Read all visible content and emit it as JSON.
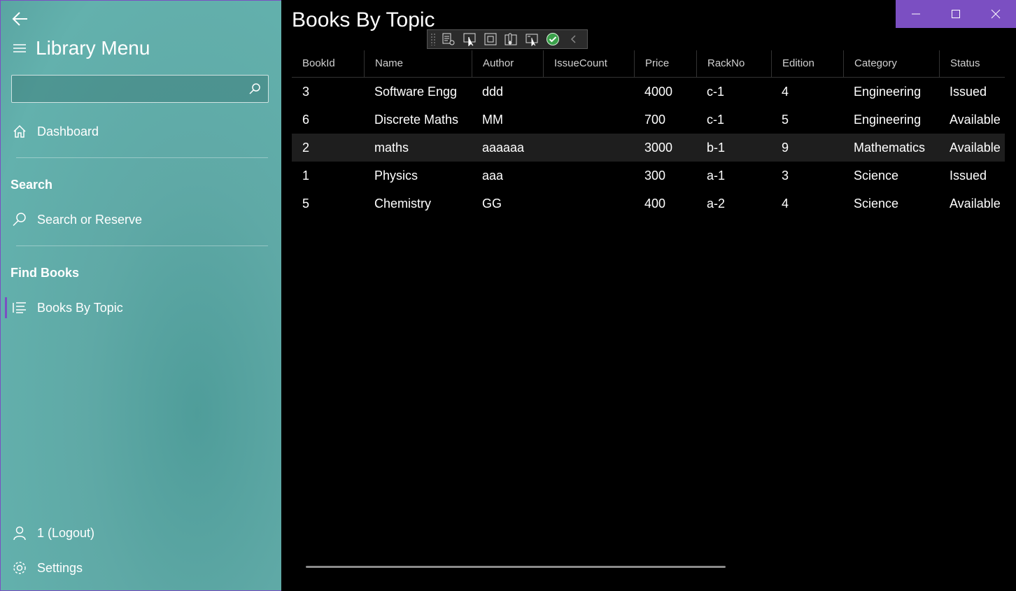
{
  "sidebar": {
    "menu_title": "Library Menu",
    "search": {
      "value": "",
      "placeholder": ""
    },
    "dashboard_label": "Dashboard",
    "sections": [
      {
        "header": "Search",
        "item_label": "Search or Reserve"
      },
      {
        "header": "Find Books",
        "item_label": "Books By Topic"
      }
    ],
    "active_item": "Books By Topic",
    "logout_label": "1 (Logout)",
    "settings_label": "Settings",
    "accent_color": "#7b4fc2"
  },
  "main": {
    "page_title": "Books By Topic"
  },
  "table": {
    "columns": [
      "BookId",
      "Name",
      "Author",
      "IssueCount",
      "Price",
      "RackNo",
      "Edition",
      "Category",
      "Status"
    ],
    "rows": [
      [
        "3",
        "Software Engg",
        "ddd",
        "",
        "4000",
        "c-1",
        "4",
        "Engineering",
        "Issued"
      ],
      [
        "6",
        "Discrete Maths",
        "MM",
        "",
        "700",
        "c-1",
        "5",
        "Engineering",
        "Available"
      ],
      [
        "2",
        "maths",
        "aaaaaa",
        "",
        "3000",
        "b-1",
        "9",
        "Mathematics",
        "Available"
      ],
      [
        "1",
        "Physics",
        "aaa",
        "",
        "300",
        "a-1",
        "3",
        "Science",
        "Issued"
      ],
      [
        "5",
        "Chemistry",
        "GG",
        "",
        "400",
        "a-2",
        "4",
        "Science",
        "Available"
      ]
    ],
    "selected_row": 2
  }
}
